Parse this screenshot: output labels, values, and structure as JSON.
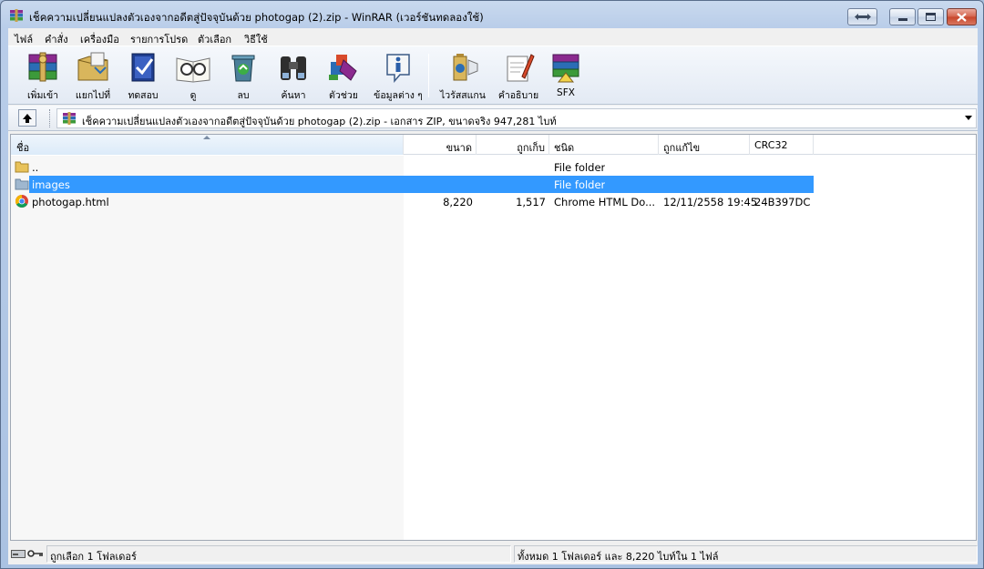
{
  "window": {
    "title": "เช็คความเปลี่ยนแปลงตัวเองจากอดีตสู่ปัจจุบันด้วย photogap (2).zip - WinRAR (เวอร์ชันทดลองใช้)"
  },
  "menu": [
    "ไฟล์",
    "คำสั่ง",
    "เครื่องมือ",
    "รายการโปรด",
    "ตัวเลือก",
    "วิธีใช้"
  ],
  "toolbar": {
    "buttons": [
      {
        "label": "เพิ่มเข้า",
        "icon": "add-archive-icon"
      },
      {
        "label": "แยกไปที่",
        "icon": "extract-icon"
      },
      {
        "label": "ทดสอบ",
        "icon": "test-icon"
      },
      {
        "label": "ดู",
        "icon": "view-icon"
      },
      {
        "label": "ลบ",
        "icon": "delete-icon"
      },
      {
        "label": "ค้นหา",
        "icon": "find-icon"
      },
      {
        "label": "ตัวช่วย",
        "icon": "wizard-icon"
      },
      {
        "label": "ข้อมูลต่าง ๆ",
        "icon": "info-icon"
      },
      {
        "label": "ไวรัสสแกน",
        "icon": "virus-scan-icon"
      },
      {
        "label": "คำอธิบาย",
        "icon": "comment-icon"
      },
      {
        "label": "SFX",
        "icon": "sfx-icon"
      }
    ]
  },
  "address": {
    "text": "เช็คความเปลี่ยนแปลงตัวเองจากอดีตสู่ปัจจุบันด้วย photogap (2).zip - เอกสาร ZIP, ขนาดจริง 947,281 ไบท์"
  },
  "columns": {
    "name": "ชื่อ",
    "size": "ขนาด",
    "packed": "ถูกเก็บ",
    "type": "ชนิด",
    "modified": "ถูกแก้ไข",
    "crc": "CRC32"
  },
  "files": [
    {
      "name": "..",
      "size": "",
      "packed": "",
      "type": "File folder",
      "modified": "",
      "crc": "",
      "icon": "folder-icon",
      "selected": false
    },
    {
      "name": "images",
      "size": "",
      "packed": "",
      "type": "File folder",
      "modified": "",
      "crc": "",
      "icon": "folder-icon",
      "selected": true
    },
    {
      "name": "photogap.html",
      "size": "8,220",
      "packed": "1,517",
      "type": "Chrome HTML Do...",
      "modified": "12/11/2558 19:45",
      "crc": "24B397DC",
      "icon": "chrome-icon",
      "selected": false
    }
  ],
  "status": {
    "left": "ถูกเลือก 1 โฟลเดอร์",
    "right": "ทั้งหมด 1 โฟลเดอร์ และ 8,220 ไบท์ใน 1 ไฟล์"
  },
  "colors": {
    "selection": "#3399ff",
    "title_gradient_top": "#c9d9ee",
    "close_button": "#c7452b"
  }
}
